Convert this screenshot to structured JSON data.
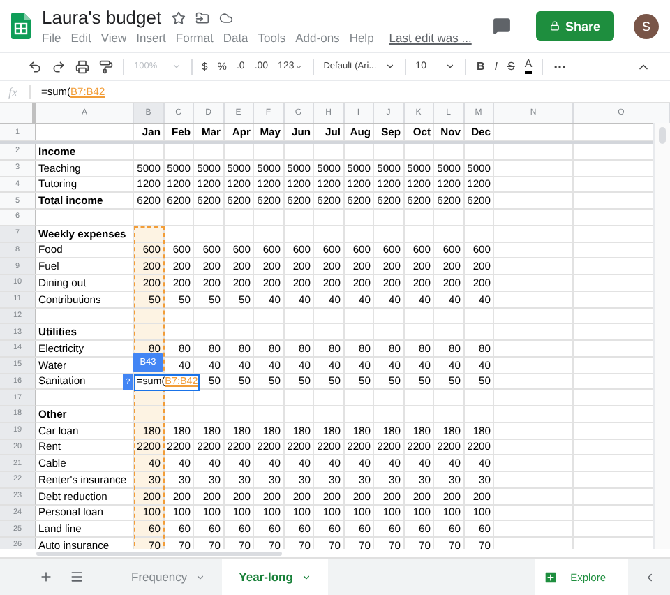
{
  "header": {
    "title": "Laura's budget",
    "menus": [
      "File",
      "Edit",
      "View",
      "Insert",
      "Format",
      "Data",
      "Tools",
      "Add-ons",
      "Help"
    ],
    "last_edit": "Last edit was ...",
    "share": "Share",
    "avatar": "S"
  },
  "toolbar": {
    "zoom": "100%",
    "currency": "$",
    "percent": "%",
    "decrease_decimals": ".0",
    "increase_decimals": ".00",
    "number_formats": "123",
    "font": "Default (Ari...",
    "font_size": "10",
    "bold": "B",
    "italic": "I",
    "strikethrough": "S",
    "text_color": "A"
  },
  "formula_bar": {
    "label": "fx",
    "prefix": "=sum(",
    "range": "B7:B42"
  },
  "grid": {
    "columns": [
      {
        "label": "A",
        "selected": false
      },
      {
        "label": "B",
        "selected": true
      },
      {
        "label": "C",
        "selected": false
      },
      {
        "label": "D",
        "selected": false
      },
      {
        "label": "E",
        "selected": false
      },
      {
        "label": "F",
        "selected": false
      },
      {
        "label": "G",
        "selected": false
      },
      {
        "label": "H",
        "selected": false
      },
      {
        "label": "I",
        "selected": false
      },
      {
        "label": "J",
        "selected": false
      },
      {
        "label": "K",
        "selected": false
      },
      {
        "label": "L",
        "selected": false
      },
      {
        "label": "M",
        "selected": false
      },
      {
        "label": "N",
        "selected": false
      },
      {
        "label": "O",
        "selected": false
      }
    ],
    "rows": [
      {
        "number": "1",
        "bold": true,
        "in_range": false,
        "values": [
          "Jan",
          "Feb",
          "Mar",
          "Apr",
          "May",
          "Jun",
          "Jul",
          "Aug",
          "Sep",
          "Oct",
          "Nov",
          "Dec"
        ]
      },
      {
        "number": "2",
        "label": "Income",
        "bold": true,
        "in_range": false
      },
      {
        "number": "3",
        "label": "Teaching",
        "bold": false,
        "in_range": false,
        "values": [
          "5000",
          "5000",
          "5000",
          "5000",
          "5000",
          "5000",
          "5000",
          "5000",
          "5000",
          "5000",
          "5000",
          "5000"
        ]
      },
      {
        "number": "4",
        "label": "Tutoring",
        "bold": false,
        "in_range": false,
        "values": [
          "1200",
          "1200",
          "1200",
          "1200",
          "1200",
          "1200",
          "1200",
          "1200",
          "1200",
          "1200",
          "1200",
          "1200"
        ]
      },
      {
        "number": "5",
        "label": "Total income",
        "bold": true,
        "in_range": false,
        "values": [
          "6200",
          "6200",
          "6200",
          "6200",
          "6200",
          "6200",
          "6200",
          "6200",
          "6200",
          "6200",
          "6200",
          "6200"
        ]
      },
      {
        "number": "6",
        "in_range": false
      },
      {
        "number": "7",
        "label": "Weekly expenses",
        "bold": true,
        "in_range": true
      },
      {
        "number": "8",
        "label": "Food",
        "bold": false,
        "in_range": true,
        "values": [
          "600",
          "600",
          "600",
          "600",
          "600",
          "600",
          "600",
          "600",
          "600",
          "600",
          "600",
          "600"
        ]
      },
      {
        "number": "9",
        "label": "Fuel",
        "bold": false,
        "in_range": true,
        "values": [
          "200",
          "200",
          "200",
          "200",
          "200",
          "200",
          "200",
          "200",
          "200",
          "200",
          "200",
          "200"
        ]
      },
      {
        "number": "10",
        "label": "Dining out",
        "bold": false,
        "in_range": true,
        "values": [
          "200",
          "200",
          "200",
          "200",
          "200",
          "200",
          "200",
          "200",
          "200",
          "200",
          "200",
          "200"
        ]
      },
      {
        "number": "11",
        "label": "Contributions",
        "bold": false,
        "in_range": true,
        "values": [
          "50",
          "50",
          "50",
          "50",
          "40",
          "40",
          "40",
          "40",
          "40",
          "40",
          "40",
          "40"
        ]
      },
      {
        "number": "12",
        "in_range": true
      },
      {
        "number": "13",
        "label": "Utilities",
        "bold": true,
        "in_range": true
      },
      {
        "number": "14",
        "label": "Electricity",
        "bold": false,
        "in_range": true,
        "values": [
          "80",
          "80",
          "80",
          "80",
          "80",
          "80",
          "80",
          "80",
          "80",
          "80",
          "80",
          "80"
        ]
      },
      {
        "number": "15",
        "label": "Water",
        "bold": false,
        "in_range": true,
        "values": [
          "40",
          "40",
          "40",
          "40",
          "40",
          "40",
          "40",
          "40",
          "40",
          "40",
          "40"
        ]
      },
      {
        "number": "16",
        "label": "Sanitation",
        "bold": false,
        "in_range": true,
        "values": [
          "50",
          "50",
          "50",
          "50",
          "50",
          "50",
          "50",
          "50",
          "50",
          "50"
        ]
      },
      {
        "number": "17",
        "in_range": true
      },
      {
        "number": "18",
        "label": "Other",
        "bold": true,
        "in_range": true
      },
      {
        "number": "19",
        "label": "Car loan",
        "bold": false,
        "in_range": true,
        "values": [
          "180",
          "180",
          "180",
          "180",
          "180",
          "180",
          "180",
          "180",
          "180",
          "180",
          "180",
          "180"
        ]
      },
      {
        "number": "20",
        "label": "Rent",
        "bold": false,
        "in_range": true,
        "values": [
          "2200",
          "2200",
          "2200",
          "2200",
          "2200",
          "2200",
          "2200",
          "2200",
          "2200",
          "2200",
          "2200",
          "2200"
        ]
      },
      {
        "number": "21",
        "label": "Cable",
        "bold": false,
        "in_range": true,
        "values": [
          "40",
          "40",
          "40",
          "40",
          "40",
          "40",
          "40",
          "40",
          "40",
          "40",
          "40",
          "40"
        ]
      },
      {
        "number": "22",
        "label": "Renter's insurance",
        "bold": false,
        "in_range": true,
        "values": [
          "30",
          "30",
          "30",
          "30",
          "30",
          "30",
          "30",
          "30",
          "30",
          "30",
          "30",
          "30"
        ]
      },
      {
        "number": "23",
        "label": "Debt reduction",
        "bold": false,
        "in_range": true,
        "values": [
          "200",
          "200",
          "200",
          "200",
          "200",
          "200",
          "200",
          "200",
          "200",
          "200",
          "200",
          "200"
        ]
      },
      {
        "number": "24",
        "label": "Personal loan",
        "bold": false,
        "in_range": true,
        "values": [
          "100",
          "100",
          "100",
          "100",
          "100",
          "100",
          "100",
          "100",
          "100",
          "100",
          "100",
          "100"
        ]
      },
      {
        "number": "25",
        "label": "Land line",
        "bold": false,
        "in_range": true,
        "values": [
          "60",
          "60",
          "60",
          "60",
          "60",
          "60",
          "60",
          "60",
          "60",
          "60",
          "60",
          "60"
        ]
      },
      {
        "number": "26",
        "label": "Auto insurance",
        "bold": false,
        "in_range": true,
        "values": [
          "70",
          "70",
          "70",
          "70",
          "70",
          "70",
          "70",
          "70",
          "70",
          "70",
          "70",
          "70"
        ]
      }
    ]
  },
  "editor": {
    "cell_ref": "B43",
    "hint": "?",
    "prefix": "=sum(",
    "range": "B7:B42"
  },
  "sheets": {
    "tabs": [
      {
        "label": "Frequency",
        "selected": false
      },
      {
        "label": "Year-long",
        "selected": true
      }
    ],
    "explore": "Explore"
  }
}
